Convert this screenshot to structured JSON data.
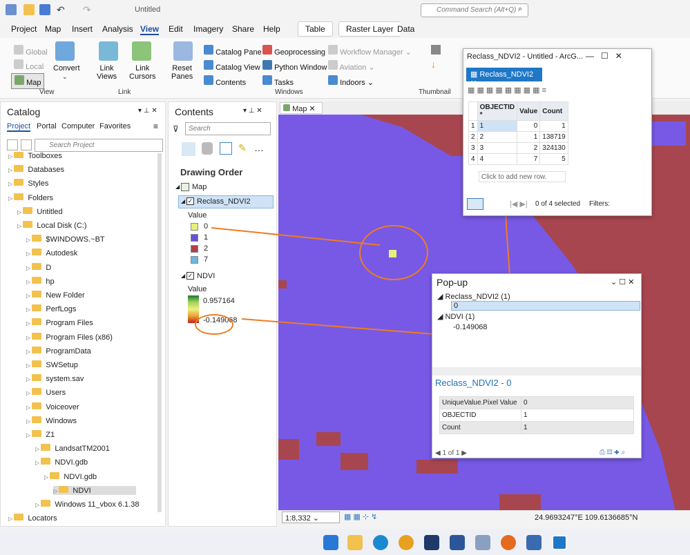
{
  "window": {
    "title": "Untitled",
    "command_search_placeholder": "Command Search (Alt+Q)"
  },
  "menu": {
    "items": [
      "Project",
      "Map",
      "Insert",
      "Analysis",
      "View",
      "Edit",
      "Imagery",
      "Share",
      "Help"
    ],
    "active": "View",
    "contextual_tabs": [
      "Table",
      "Raster Layer",
      "Data"
    ]
  },
  "ribbon": {
    "view_group": {
      "label": "View",
      "global": "Global",
      "local": "Local",
      "map": "Map",
      "convert": "Convert"
    },
    "link_group": {
      "label": "Link",
      "link_views": "Link\nViews",
      "link_cursors": "Link\nCursors"
    },
    "windows_group": {
      "label": "Windows",
      "reset_panes": "Reset\nPanes",
      "catalog_pane": "Catalog Pane",
      "catalog_view": "Catalog View",
      "contents": "Contents",
      "geoprocessing": "Geoprocessing",
      "python_window": "Python Window",
      "tasks": "Tasks",
      "workflow_manager": "Workflow Manager",
      "aviation": "Aviation",
      "indoors": "Indoors"
    },
    "thumbnail_group": {
      "label": "Thumbnail"
    }
  },
  "catalog": {
    "title": "Catalog",
    "tabs": [
      "Project",
      "Portal",
      "Computer",
      "Favorites"
    ],
    "search_placeholder": "Search Project",
    "items": [
      {
        "label": "Toolboxes",
        "level": 0
      },
      {
        "label": "Databases",
        "level": 0
      },
      {
        "label": "Styles",
        "level": 0
      },
      {
        "label": "Folders",
        "level": 0
      },
      {
        "label": "Untitled",
        "level": 1
      },
      {
        "label": "Local Disk (C:)",
        "level": 1
      },
      {
        "label": "$WINDOWS.~BT",
        "level": 2
      },
      {
        "label": "Autodesk",
        "level": 2
      },
      {
        "label": "D",
        "level": 2
      },
      {
        "label": "hp",
        "level": 2
      },
      {
        "label": "New Folder",
        "level": 2
      },
      {
        "label": "PerfLogs",
        "level": 2
      },
      {
        "label": "Program Files",
        "level": 2
      },
      {
        "label": "Program Files (x86)",
        "level": 2
      },
      {
        "label": "ProgramData",
        "level": 2
      },
      {
        "label": "SWSetup",
        "level": 2
      },
      {
        "label": "system.sav",
        "level": 2
      },
      {
        "label": "Users",
        "level": 2
      },
      {
        "label": "Voiceover",
        "level": 2
      },
      {
        "label": "Windows",
        "level": 2
      },
      {
        "label": "Z1",
        "level": 2
      },
      {
        "label": "LandsatTM2001",
        "level": 3
      },
      {
        "label": "NDVI.gdb",
        "level": 3
      },
      {
        "label": "NDVI.gdb",
        "level": 4
      },
      {
        "label": "NDVI",
        "level": 5
      },
      {
        "label": "Windows 11_vbox 6.1.38",
        "level": 3
      },
      {
        "label": "Locators",
        "level": 0
      }
    ]
  },
  "contents": {
    "title": "Contents",
    "search_placeholder": "Search",
    "drawing_order": "Drawing Order",
    "map": "Map",
    "layer1": {
      "name": "Reclass_NDVI2",
      "value_label": "Value",
      "classes": [
        {
          "label": "0",
          "color": "#e8f07a"
        },
        {
          "label": "1",
          "color": "#6a50d8"
        },
        {
          "label": "2",
          "color": "#b0404a"
        },
        {
          "label": "7",
          "color": "#6ab7e0"
        }
      ]
    },
    "layer2": {
      "name": "NDVI",
      "value_label": "Value",
      "max": "0.957164",
      "min": "-0.149068"
    }
  },
  "map_tab": {
    "label": "Map"
  },
  "statusbar": {
    "scale": "1:8,332",
    "coords": "24.9693247°E 109.6136685°N"
  },
  "attribute_table": {
    "title": "Reclass_NDVI2 - Untitled - ArcG...",
    "tab": "Reclass_NDVI2",
    "columns": [
      "OBJECTID *",
      "Value",
      "Count"
    ],
    "rows": [
      [
        "1",
        "1",
        "0",
        "1"
      ],
      [
        "2",
        "2",
        "1",
        "138719"
      ],
      [
        "3",
        "3",
        "2",
        "324130"
      ],
      [
        "4",
        "4",
        "7",
        "5"
      ]
    ],
    "add_row": "Click to add new row.",
    "selected": "0 of 4 selected",
    "filters": "Filters:"
  },
  "popup": {
    "title": "Pop-up",
    "layer1": "Reclass_NDVI2 (1)",
    "layer1_value": "0",
    "layer2": "NDVI (1)",
    "layer2_value": "-0.149068",
    "heading": "Reclass_NDVI2 - 0",
    "fields": [
      [
        "UniqueValue.Pixel Value",
        "0"
      ],
      [
        "OBJECTID",
        "1"
      ],
      [
        "Count",
        "1"
      ]
    ],
    "pager": "1 of 1"
  }
}
